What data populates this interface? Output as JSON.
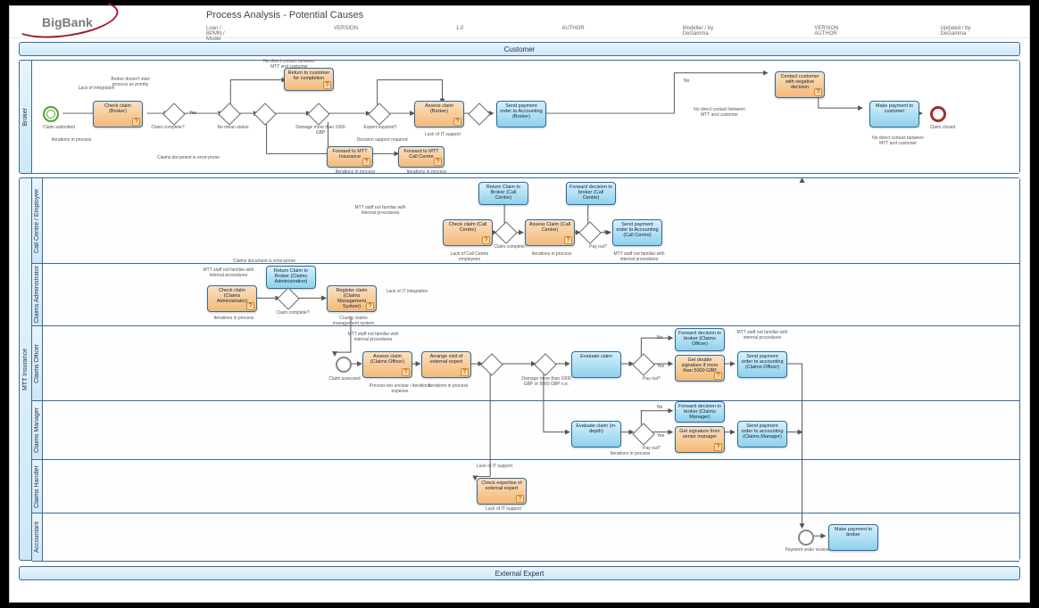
{
  "logo_text": "BigBank",
  "title": "Process Analysis - Potential Causes",
  "meta": {
    "name": "Loan / BPMN / Model",
    "version_lbl": "VERSION",
    "version": "1.0",
    "author_lbl": "AUTHOR",
    "author": "Modeller / by DeGamma",
    "va_lbl": "VERSION AUTHOR",
    "updated": "Updated / by DeGamma"
  },
  "pools": {
    "customer": "Customer",
    "external": "External Expert",
    "mtt": "MTT Insurance"
  },
  "lanes": {
    "broker": "Broker",
    "callcentre": "Call Centre / Employee",
    "claimsadmin": "Claims Administrator",
    "claimsofficer": "Claims Officer",
    "claimsmanager": "Claims Manager",
    "claimshandler": "Claims Handler",
    "accountant": "Accountant"
  },
  "events": {
    "claim_submitted": "Claim submitted",
    "claim_closed": "Claim closed",
    "payment_received": "Payment order received"
  },
  "tasks": {
    "check_broker": "Check claim (Broker)",
    "return_customer": "Return to customer for completion",
    "assess_broker": "Assess claim (Broker)",
    "send_accounting_broker": "Send payment order to Accounting (Broker)",
    "contact_negative": "Contact customer with negative decision",
    "make_payment_customer": "Make payment to customer",
    "fwd_mtt_ins": "Forward to MTT Insurance",
    "fwd_mtt_cc": "Forward to MTT Call Centre",
    "check_cc": "Check claim (Call Centre)",
    "return_broker_cc": "Return Claim to Broker (Call Centre)",
    "assess_cc": "Assess Claim (Call Centre)",
    "fwd_broker_cc": "Forward decision to broker (Call Centre)",
    "send_accounting_cc": "Send payment order to Accounting (Call Centre)",
    "check_ca": "Check claim (Claims Administrator)",
    "return_broker_ca": "Return Claim to Broker (Claims Administration)",
    "register": "Register claim (Claims Management System)",
    "assess_co": "Assess claim (Claims Officer)",
    "arrange_visit": "Arrange visit of external expert",
    "evaluate": "Evaluate claim",
    "fwd_broker_co": "Forward decision to broker (Claims Officer)",
    "double_sig": "Get double signature if more than 5000 GBP",
    "send_accounting_co": "Send payment order to accounting (Claims Officer)",
    "evaluate_depth": "Evaluate claim (in-depth)",
    "fwd_broker_cm": "Forward decision to broker (Claims Manager)",
    "get_sig_senior": "Get signature from senior manager",
    "send_accounting_cm": "Send payment order to accounting (Claims Manager)",
    "check_expertise": "Check expertise of external expert",
    "make_payment_broker": "Make payment to broker"
  },
  "notes": {
    "no_direct_contact": "No direct contact between MTT and customer",
    "broker_process_delay": "Broker doesn't start process as priority",
    "lack_integration": "Lack of integration",
    "no_mean_status": "No mean status",
    "damage_more": "Damage more than 1000 GBP",
    "expert_required": "Expert required?",
    "decision_support": "Decision support required",
    "iterations": "Iterations in process",
    "claims_error": "Claims document is error-prone",
    "mtt_internal": "MTT staff not familiar with internal procedures",
    "lack_cc": "Lack of Call Centre employees",
    "iter_cc": "Iterations in process",
    "lack_integration2": "Lack of IT integration",
    "county_claims": "County claims management system",
    "claim_complete": "Claim complete?",
    "process_unclear": "Process too unclear / iterations expense",
    "damage_1000_5000": "Damage more than 1000 GBP or 5000 GBP n.e.",
    "lack_it": "Lack of IT support",
    "payout": "Pay out?",
    "yes": "Yes",
    "no": "No",
    "iter2": "Iterations in process",
    "claim_assessed": "Claim assessed"
  }
}
